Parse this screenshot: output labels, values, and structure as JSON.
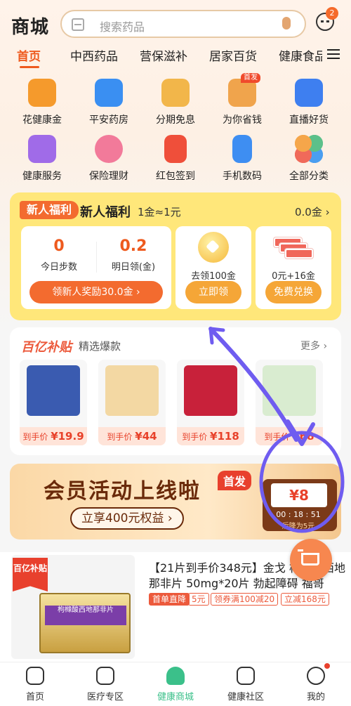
{
  "header": {
    "title": "商城",
    "search_placeholder": "搜索药品",
    "msg_badge": "2"
  },
  "categories": [
    "首页",
    "中西药品",
    "营保滋补",
    "居家百货",
    "健康食品"
  ],
  "grid": [
    {
      "label": "花健康金",
      "icon": "heart-bag-icon",
      "color": "#f59a2c"
    },
    {
      "label": "平安药房",
      "icon": "pharmacy-icon",
      "color": "#3a8ff2"
    },
    {
      "label": "分期免息",
      "icon": "card-icon",
      "color": "#f2b64a"
    },
    {
      "label": "为你省钱",
      "icon": "vip-icon",
      "color": "#f0a44c",
      "tag": "首发"
    },
    {
      "label": "直播好货",
      "icon": "tv-icon",
      "color": "#3e7ff0"
    },
    {
      "label": "健康服务",
      "icon": "health-service-icon",
      "color": "#a06be8"
    },
    {
      "label": "保险理财",
      "icon": "piggy-bank-icon",
      "color": "#f27a9a"
    },
    {
      "label": "红包签到",
      "icon": "red-packet-icon",
      "color": "#ef4f3a"
    },
    {
      "label": "手机数码",
      "icon": "phone-icon",
      "color": "#3e8ef2"
    },
    {
      "label": "全部分类",
      "icon": "all-category-icon",
      "color": "#f2a33a"
    }
  ],
  "welfare": {
    "tag": "新人福利",
    "title": "新人福利",
    "rate": "1金≈1元",
    "balance": "0.0金",
    "steps_value": "0",
    "steps_label": "今日步数",
    "tomorrow_value": "0.2",
    "tomorrow_label": "明日领(金)",
    "reward_button": "领新人奖励30.0金",
    "card2_text": "去领100金",
    "card2_button": "立即领",
    "card3_text": "0元+16金",
    "card3_button": "免费兑换"
  },
  "subsidy": {
    "logo": "百亿补贴",
    "subtitle": "精选爆款",
    "more": "更多",
    "products": [
      {
        "prefix": "到手价",
        "price": "¥19.9",
        "color": "#3a5bb0"
      },
      {
        "prefix": "到手价",
        "price": "¥44",
        "color": "#f3d8a3"
      },
      {
        "prefix": "到手价",
        "price": "¥118",
        "color": "#c8213a"
      },
      {
        "prefix": "到手价",
        "price": "¥68",
        "color": "#d9ecd0"
      }
    ]
  },
  "banner": {
    "title": "会员活动上线啦",
    "tag": "首发",
    "pill": "立享400元权益",
    "amount": "¥8",
    "timer": "00 : 18 : 51",
    "drop": "后降为5元"
  },
  "product2": {
    "badge": "百亿补贴",
    "box_text": "枸橼酸西地那非片",
    "title": "【21片到手价348元】金戈 枸橼酸西地那非片 50mg*20片 勃起障碍 福哥",
    "tags": [
      "首单直降",
      "5元",
      "领券满100减20",
      "立减168元"
    ]
  },
  "tabbar": [
    {
      "label": "首页",
      "icon": "home-icon"
    },
    {
      "label": "医疗专区",
      "icon": "medical-icon"
    },
    {
      "label": "健康商城",
      "icon": "heart-shop-icon"
    },
    {
      "label": "健康社区",
      "icon": "chat-icon"
    },
    {
      "label": "我的",
      "icon": "smile-icon"
    }
  ]
}
